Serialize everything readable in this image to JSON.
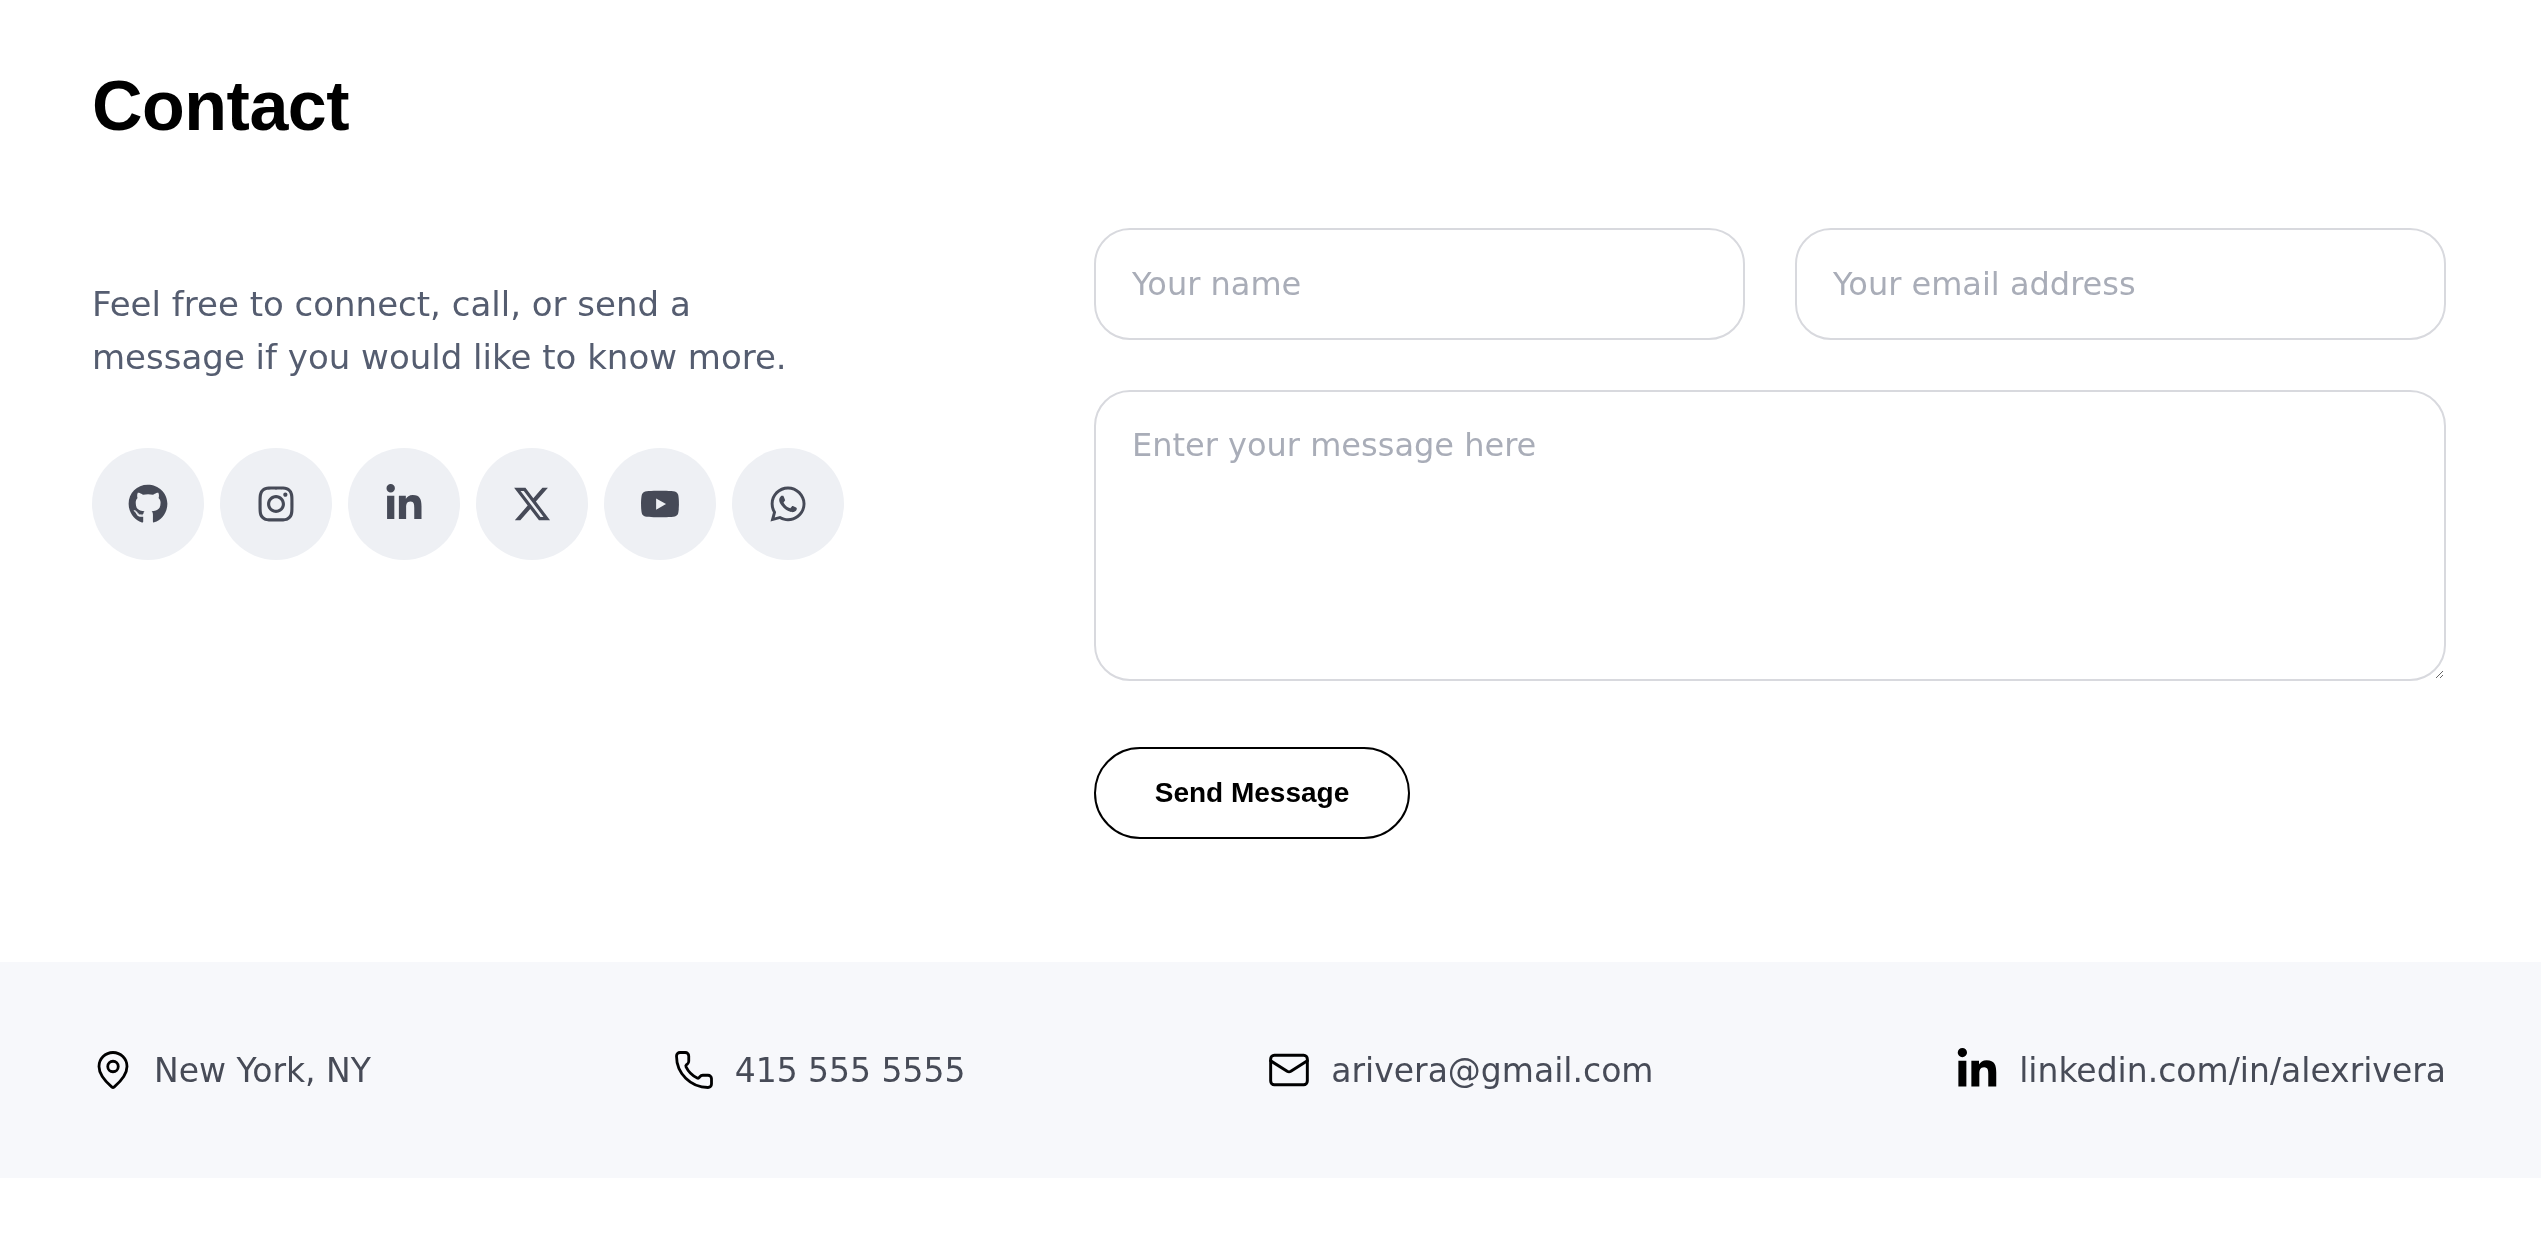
{
  "title": "Contact",
  "intro": "Feel free to connect, call, or send a message if you would like to know more.",
  "socials": [
    {
      "kind": "github"
    },
    {
      "kind": "instagram"
    },
    {
      "kind": "linkedin"
    },
    {
      "kind": "x"
    },
    {
      "kind": "youtube"
    },
    {
      "kind": "whatsapp"
    }
  ],
  "form": {
    "name": {
      "placeholder": "Your name"
    },
    "email": {
      "placeholder": "Your email address"
    },
    "message": {
      "placeholder": "Enter your message here"
    },
    "submit": "Send Message"
  },
  "footer": [
    {
      "kind": "location",
      "text": "New York, NY"
    },
    {
      "kind": "phone",
      "text": "415 555 5555"
    },
    {
      "kind": "email",
      "text": "arivera@gmail.com"
    },
    {
      "kind": "linkedin",
      "text": "linkedin.com/in/alexrivera"
    }
  ]
}
